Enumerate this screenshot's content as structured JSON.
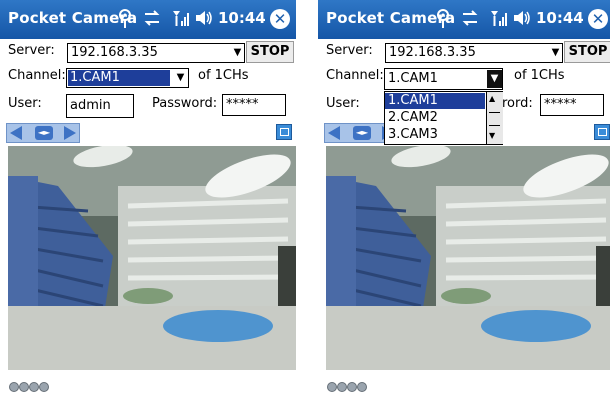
{
  "panel_left": {
    "title": "Pocket Camera",
    "time": "10:44",
    "server_label": "Server:",
    "server_value": "192.168.3.35",
    "stop_label": "STOP",
    "channel_label": "Channel:",
    "channel_value": "1.CAM1",
    "channel_count": "of 1CHs",
    "user_label": "User:",
    "user_value": "admin",
    "password_label": "Password:",
    "password_value": "*****"
  },
  "panel_right": {
    "title": "Pocket Camera",
    "time": "10:44",
    "server_label": "Server:",
    "server_value": "192.168.3.35",
    "stop_label": "STOP",
    "channel_label": "Channel:",
    "channel_value": "1.CAM1",
    "channel_count": "of 1CHs",
    "user_label": "User:",
    "password_label_partial": "rord:",
    "password_value": "*****",
    "channel_options": [
      "1.CAM1",
      "2.CAM2",
      "3.CAM3"
    ]
  },
  "icons": {
    "antenna": "antenna-icon",
    "sync": "sync-icon",
    "signal": "signal-icon",
    "volume": "volume-icon",
    "close": "close-icon",
    "pan": "pan-control-icon",
    "fullscreen": "fullscreen-icon"
  },
  "colors": {
    "titlebar": "#1e5fad",
    "selection": "#1e3e9a",
    "pan": "#3d72c4"
  }
}
